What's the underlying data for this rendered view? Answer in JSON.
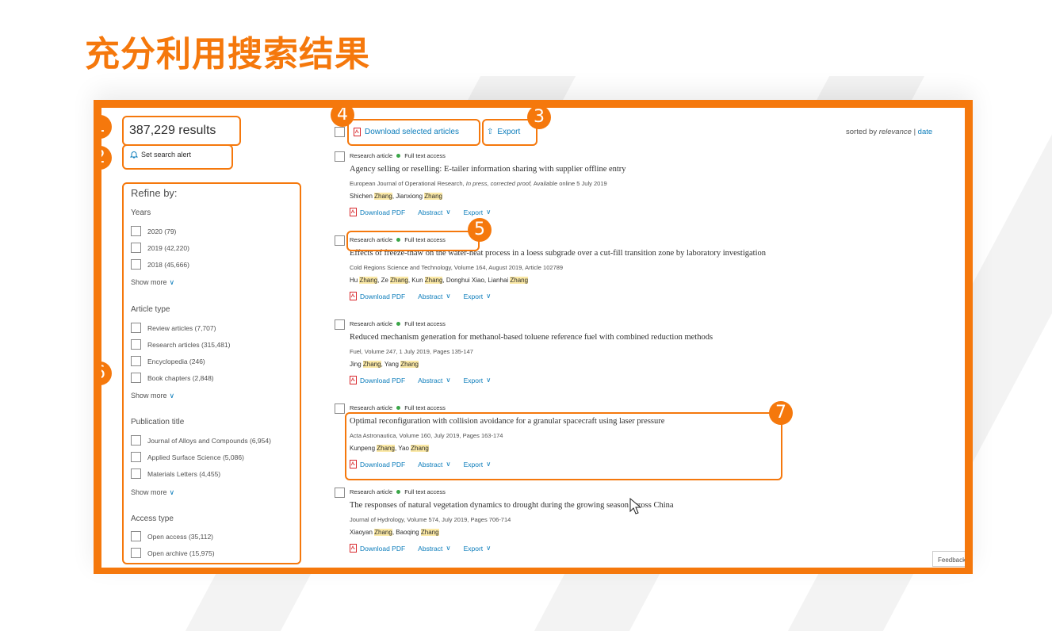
{
  "slide_title": "充分利用搜索结果",
  "accent_color": "#f5780c",
  "link_color": "#0c7dbb",
  "results_count": "387,229 results",
  "search_alert": {
    "label": "Set search alert",
    "icon": "bell-icon"
  },
  "toolbar": {
    "download_label": "Download selected articles",
    "export_label": "Export",
    "sorted_by_prefix": "sorted by",
    "sort_relevance": "relevance",
    "sort_separator": "|",
    "sort_date": "date"
  },
  "sidebar": {
    "refine_label": "Refine by:",
    "show_more_label": "Show more",
    "facets": [
      {
        "title": "Years",
        "items": [
          "2020 (79)",
          "2019 (42,220)",
          "2018 (45,666)"
        ]
      },
      {
        "title": "Article type",
        "items": [
          "Review articles (7,707)",
          "Research articles (315,481)",
          "Encyclopedia (246)",
          "Book chapters (2,848)"
        ]
      },
      {
        "title": "Publication title",
        "items": [
          "Journal of Alloys and Compounds (6,954)",
          "Applied Surface Science (5,086)",
          "Materials Letters (4,455)"
        ]
      },
      {
        "title": "Access type",
        "items": [
          "Open access (35,112)",
          "Open archive (15,975)"
        ]
      }
    ]
  },
  "articles": [
    {
      "type": "Research article",
      "access": "Full text access",
      "title": "Agency selling or reselling: E-tailer information sharing with supplier offline entry",
      "source": "European Journal of Operational Research,",
      "source_em": "In press, corrected proof,",
      "source_tail": "Available online 5 July 2019",
      "authors": [
        {
          "text": "Shichen "
        },
        {
          "text": "Zhang",
          "hl": true
        },
        {
          "text": ", Jianxiong "
        },
        {
          "text": "Zhang",
          "hl": true
        }
      ]
    },
    {
      "type": "Research article",
      "access": "Full text access",
      "title": "Effects of freeze-thaw on the water-heat process in a loess subgrade over a cut-fill transition zone by laboratory investigation",
      "source": "Cold Regions Science and Technology, Volume 164, August 2019, Article 102789",
      "source_em": "",
      "source_tail": "",
      "authors": [
        {
          "text": "Hu "
        },
        {
          "text": "Zhang",
          "hl": true
        },
        {
          "text": ", Ze "
        },
        {
          "text": "Zhang",
          "hl": true
        },
        {
          "text": ", Kun "
        },
        {
          "text": "Zhang",
          "hl": true
        },
        {
          "text": ", Donghui Xiao, Lianhai "
        },
        {
          "text": "Zhang",
          "hl": true
        }
      ]
    },
    {
      "type": "Research article",
      "access": "Full text access",
      "title": "Reduced mechanism generation for methanol-based toluene reference fuel with combined reduction methods",
      "source": "Fuel, Volume 247, 1 July 2019, Pages 135-147",
      "source_em": "",
      "source_tail": "",
      "authors": [
        {
          "text": "Jing "
        },
        {
          "text": "Zhang",
          "hl": true
        },
        {
          "text": ", Yang "
        },
        {
          "text": "Zhang",
          "hl": true
        }
      ]
    },
    {
      "type": "Research article",
      "access": "Full text access",
      "title": "Optimal reconfiguration with collision avoidance for a granular spacecraft using laser pressure",
      "source": "Acta Astronautica, Volume 160, July 2019, Pages 163-174",
      "source_em": "",
      "source_tail": "",
      "authors": [
        {
          "text": "Kunpeng "
        },
        {
          "text": "Zhang",
          "hl": true
        },
        {
          "text": ", Yao "
        },
        {
          "text": "Zhang",
          "hl": true
        }
      ]
    },
    {
      "type": "Research article",
      "access": "Full text access",
      "title": "The responses of natural vegetation dynamics to drought during the growing season across China",
      "source": "Journal of Hydrology, Volume 574, July 2019, Pages 706-714",
      "source_em": "",
      "source_tail": "",
      "authors": [
        {
          "text": "Xiaoyan "
        },
        {
          "text": "Zhang",
          "hl": true
        },
        {
          "text": ", Baoqing "
        },
        {
          "text": "Zhang",
          "hl": true
        }
      ]
    }
  ],
  "article_actions": {
    "download_pdf": "Download PDF",
    "abstract": "Abstract",
    "export": "Export"
  },
  "callouts": [
    "1",
    "2",
    "3",
    "4",
    "5",
    "6",
    "7"
  ],
  "feedback_label": "Feedback"
}
